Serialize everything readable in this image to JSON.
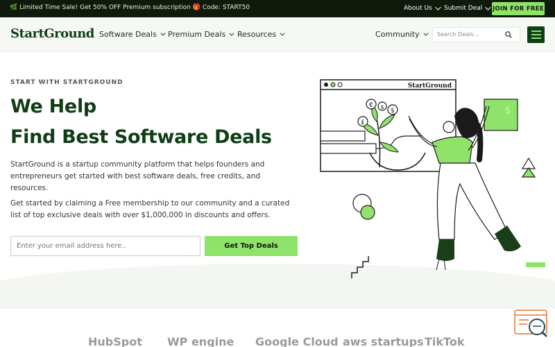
{
  "promo": {
    "text": "🌿 Limited Time Sale! Get 50% OFF Premium subscription 🎁 Code: START50",
    "about": "About Us",
    "submit": "Submit Deal",
    "join": "JOIN FOR FREE"
  },
  "header": {
    "logo": "StartGround",
    "nav": [
      "Software Deals",
      "Premium Deals",
      "Resources"
    ],
    "community": "Community",
    "search_placeholder": "Search Deals..."
  },
  "hero": {
    "eyebrow": "START WITH STARTGROUND",
    "title_line1": "We Help",
    "title_line2": "Find Best Software Deals",
    "para1": "StartGround is a startup community platform that helps founders and entrepreneurs get started with best software deals, free credits, and resources.",
    "para2": "Get started by claiming a Free membership to our community and a curated list of top exclusive deals with over $1,000,000 in discounts and offers.",
    "email_placeholder": "Enter your email address here..",
    "cta": "Get Top Deals",
    "illustration_window_title": "StartGround"
  },
  "brands": [
    "HubSpot",
    "WP engine",
    "Google Cloud",
    "aws startups",
    "TikTok"
  ],
  "colors": {
    "accent": "#8fe36b",
    "dark": "#0f3d16",
    "promo_bg": "#0f1a0c",
    "help": "#e8742f"
  }
}
